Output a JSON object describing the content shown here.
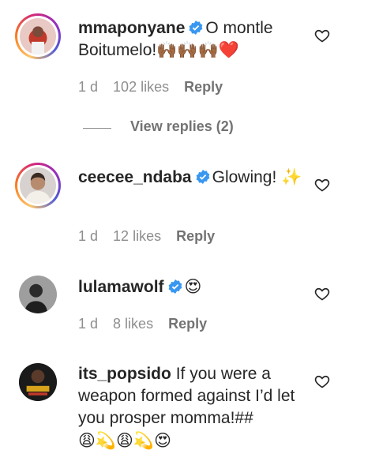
{
  "comments": [
    {
      "username": "mmaponyane",
      "verified": true,
      "text": "O montle Boitumelo!🙌🏾🙌🏾🙌🏾❤️",
      "time": "1 d",
      "likes": "102 likes",
      "reply": "Reply"
    },
    {
      "username": "ceecee_ndaba",
      "verified": true,
      "text": "Glowing! ✨",
      "time": "1 d",
      "likes": "12 likes",
      "reply": "Reply"
    },
    {
      "username": "lulamawolf",
      "verified": true,
      "text": "😍",
      "time": "1 d",
      "likes": "8 likes",
      "reply": "Reply"
    },
    {
      "username": "its_popsido",
      "verified": false,
      "text": "If you were a weapon formed against I’d let you prosper momma!##",
      "emojis": "😩💫😩💫😍"
    }
  ],
  "view_replies": "View replies (2)",
  "colors": {
    "verified": "#3897f0",
    "link": "#00376b"
  }
}
